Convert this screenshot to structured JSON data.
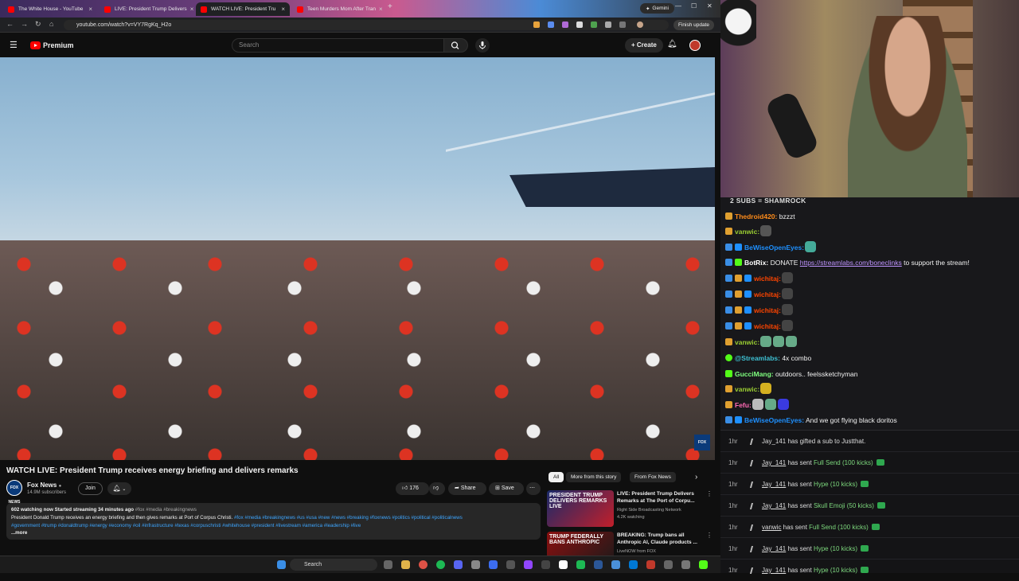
{
  "browser": {
    "tabs": [
      {
        "title": "The White House - YouTube"
      },
      {
        "title": "LIVE: President Trump Delivers"
      },
      {
        "title": "WATCH LIVE: President Tru"
      },
      {
        "title": "Teen Murders Mom After Tran"
      }
    ],
    "gemini_label": "Gemini",
    "url": "youtube.com/watch?v=VY7RgKq_H2o",
    "finish_update": "Finish update"
  },
  "youtube": {
    "logo_text": "Premium",
    "search_placeholder": "Search",
    "create_label": "Create",
    "video_title": "WATCH LIVE: President Trump receives energy briefing and delivers remarks",
    "channel": {
      "name": "Fox News",
      "subscribers": "14.9M subscribers",
      "avatar_text": "FOX NEWS"
    },
    "join_label": "Join",
    "likes": "176",
    "share_label": "Share",
    "save_label": "Save",
    "description": {
      "stats": "602 watching now  Started streaming 34 minutes ago",
      "stats_tags": "#fox #media #breakingnews",
      "body": "President Donald Trump receives an energy briefing and then gives remarks at Port of Corpus Christi.",
      "tags1": "#fox #media #breakingnews #us #usa #new #news #breaking #foxnews #politics #political #politicalnews",
      "tags2": "#government #trump #donaldtrump #energy #economy #oil #infrastructure #texas #corpuschristi #whitehouse #president #livestream #america #leadership #live",
      "more": "...more"
    },
    "chips": [
      "All",
      "More from this story",
      "From Fox News"
    ],
    "recommendations": [
      {
        "thumb_text": "PRESIDENT TRUMP DELIVERS REMARKS LIVE",
        "title": "LIVE: President Trump Delivers Remarks at The Port of Corpu...",
        "channel": "Right Side Broadcasting Network",
        "meta": "4.2K watching"
      },
      {
        "thumb_text": "TRUMP FEDERALLY BANS ANTHROPIC",
        "title": "BREAKING: Trump bans all Anthropic AI, Claude products ...",
        "channel": "LiveNOW from FOX",
        "meta": ""
      }
    ]
  },
  "taskbar": {
    "search_label": "Search"
  },
  "chat": {
    "banner": "2 SUBS = SHAMROCK",
    "messages": [
      {
        "user": "Thedroid420:",
        "text": " bzzzt",
        "color": "#ff8c1a"
      },
      {
        "user": "vanwic:",
        "text": "",
        "color": "#9acd32"
      },
      {
        "user": "BeWiseOpenEyes:",
        "text": "",
        "color": "#1e90ff"
      },
      {
        "user": "BotRix:",
        "text": " DONATE ",
        "link": "https://streamlabs.com/boneclinks",
        "text2": " to support the stream!",
        "color": "#ffffff"
      },
      {
        "user": "wichitaj:",
        "text": "",
        "color": "#ff4500"
      },
      {
        "user": "wichitaj:",
        "text": "",
        "color": "#ff4500"
      },
      {
        "user": "wichitaj:",
        "text": "",
        "color": "#ff4500"
      },
      {
        "user": "wichitaj:",
        "text": "",
        "color": "#ff4500"
      },
      {
        "user": "vanwic:",
        "text": "",
        "color": "#9acd32"
      },
      {
        "user": "@Streamlabs:",
        "text": " 4x  combo",
        "color": "#3ec1d3"
      },
      {
        "user": "GucciMang:",
        "text": " outdoors.. feelssketchyman",
        "color": "#7fff7f"
      },
      {
        "user": "vanwic:",
        "text": "",
        "color": "#9acd32"
      },
      {
        "user": "Fefu:",
        "text": "",
        "color": "#ff69b4"
      },
      {
        "user": "BeWiseOpenEyes:",
        "text": " And we got flying black doritos",
        "color": "#1e90ff"
      }
    ],
    "alerts": [
      {
        "time": "1hr",
        "name": "Jay_141",
        "mid": " has gifted a sub to ",
        "target": "Justthat."
      },
      {
        "time": "1hr",
        "name": "Jay_141",
        "mid": " has sent ",
        "item": "Full Send (100 kicks)"
      },
      {
        "time": "1hr",
        "name": "Jay_141",
        "mid": " has sent ",
        "item": "Hype (10 kicks)"
      },
      {
        "time": "1hr",
        "name": "Jay_141",
        "mid": " has sent ",
        "item": "Skull Emoji (50 kicks)"
      },
      {
        "time": "1hr",
        "name": "vanwic",
        "mid": " has sent ",
        "item": "Full Send (100 kicks)"
      },
      {
        "time": "1hr",
        "name": "Jay_141",
        "mid": " has sent ",
        "item": "Hype (10 kicks)"
      },
      {
        "time": "1hr",
        "name": "Jay_141",
        "mid": " has sent ",
        "item": "Hype (10 kicks)"
      }
    ]
  }
}
